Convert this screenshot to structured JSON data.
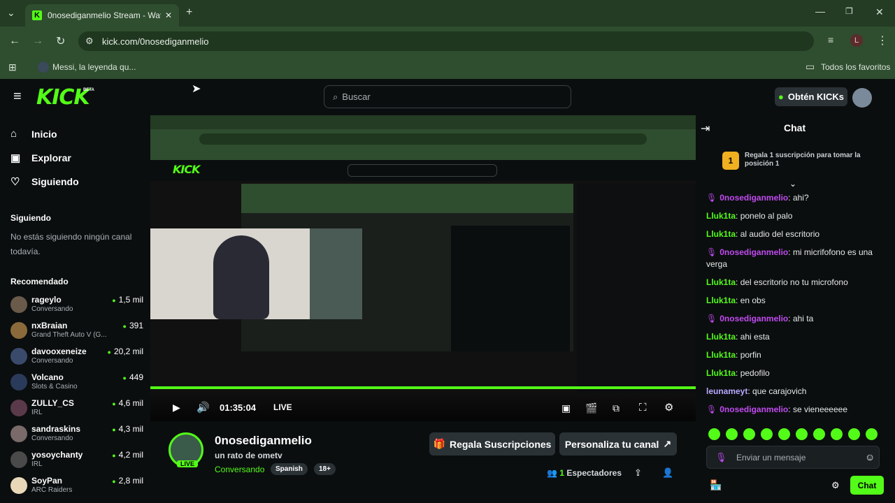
{
  "browser": {
    "tab_title": "0nosediganmelio Stream - Wat",
    "url": "kick.com/0nosediganmelio",
    "bookmark": "Messi, la leyenda qu...",
    "all_bookmarks": "Todos los favoritos",
    "profile_initial": "L"
  },
  "header": {
    "beta": "BETA",
    "search_placeholder": "Buscar",
    "get_kicks": "Obtén KICKs"
  },
  "sidebar": {
    "nav": [
      {
        "label": "Inicio"
      },
      {
        "label": "Explorar"
      },
      {
        "label": "Siguiendo"
      }
    ],
    "following_title": "Siguiendo",
    "following_empty": "No estás siguiendo ningún canal todavía.",
    "recommended_title": "Recomendado",
    "recommended": [
      {
        "name": "rageylo",
        "sub": "Conversando",
        "viewers": "1,5 mil"
      },
      {
        "name": "nxBraian",
        "sub": "Grand Theft Auto V (G...",
        "viewers": "391"
      },
      {
        "name": "davooxeneize",
        "sub": "Conversando",
        "viewers": "20,2 mil"
      },
      {
        "name": "Volcano",
        "sub": "Slots & Casino",
        "viewers": "449"
      },
      {
        "name": "ZULLY_CS",
        "sub": "IRL",
        "viewers": "4,6 mil"
      },
      {
        "name": "sandraskins",
        "sub": "Conversando",
        "viewers": "4,3 mil"
      },
      {
        "name": "yosoychanty",
        "sub": "IRL",
        "viewers": "4,2 mil"
      },
      {
        "name": "SoyPan",
        "sub": "ARC Raiders",
        "viewers": "2,8 mil"
      }
    ]
  },
  "player": {
    "time": "01:35:04",
    "live": "LIVE"
  },
  "channel": {
    "name": "0nosediganmelio",
    "title": "un rato de ometv",
    "category": "Conversando",
    "tags": [
      "Spanish",
      "18+"
    ],
    "live_badge": "LIVE",
    "gift_subs": "Regala Suscripciones",
    "customize": "Personaliza tu canal",
    "viewers_count": "1",
    "viewers_label": "Espectadores"
  },
  "chat": {
    "title": "Chat",
    "sub_goal": "Regala 1 suscripción para tomar la posición 1",
    "sub_rank": "1",
    "messages": [
      {
        "user": "0nosediganmelio",
        "text": "ahi?"
      },
      {
        "user": "Lluk1ta",
        "text": "ponelo al palo"
      },
      {
        "user": "Lluk1ta",
        "text": "al audio del escritorio"
      },
      {
        "user": "0nosediganmelio",
        "text": "mi micrifofono es una verga"
      },
      {
        "user": "Lluk1ta",
        "text": "del escritorio no tu microfono"
      },
      {
        "user": "Lluk1ta",
        "text": "en obs"
      },
      {
        "user": "0nosediganmelio",
        "text": "ahi ta"
      },
      {
        "user": "Lluk1ta",
        "text": "ahi esta"
      },
      {
        "user": "Lluk1ta",
        "text": "porfin"
      },
      {
        "user": "Lluk1ta",
        "text": "pedofilo"
      },
      {
        "user": "leunameyt",
        "text": "que carajovich"
      },
      {
        "user": "0nosediganmelio",
        "text": "se vieneeeeee"
      }
    ],
    "input_placeholder": "Enviar un mensaje",
    "send_label": "Chat"
  },
  "colors": {
    "kick_green": "#53fc18",
    "streamer_purple": "#c04bf0",
    "user_green": "#53fc18",
    "user_lavender": "#b6a8ff"
  }
}
